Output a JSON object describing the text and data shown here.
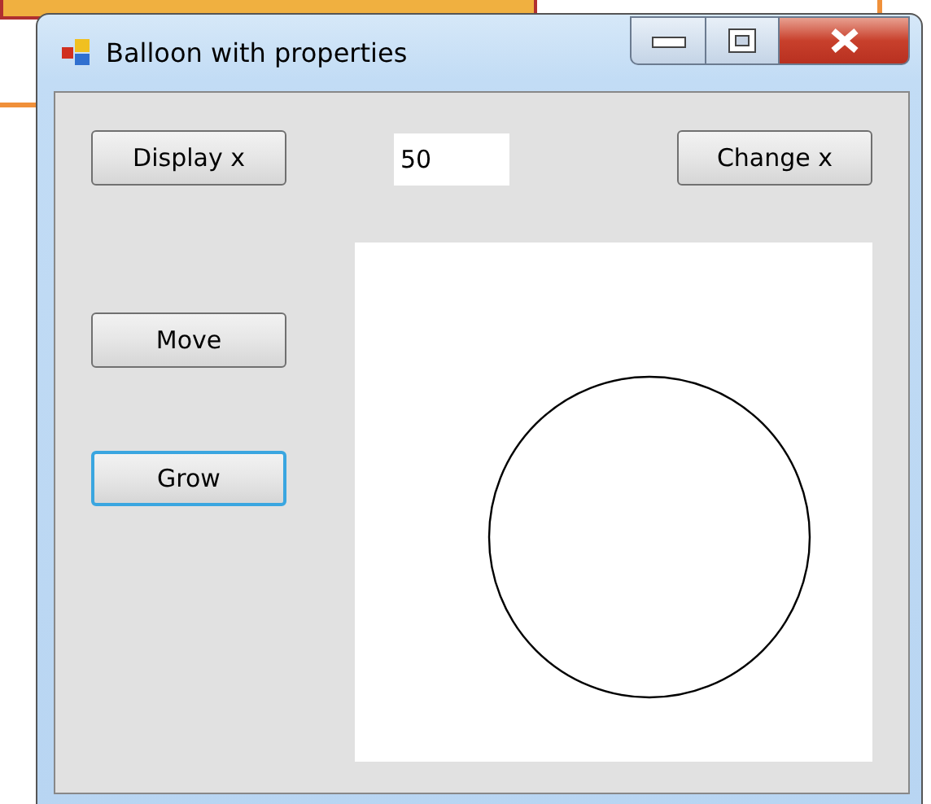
{
  "window": {
    "title": "Balloon with properties"
  },
  "display_button": {
    "label": "Display x",
    "focused": false
  },
  "x_field": {
    "value": "50"
  },
  "change_button": {
    "label": "Change x",
    "focused": false
  },
  "side_buttons": [
    {
      "label": "Move",
      "focused": false
    },
    {
      "label": "Grow",
      "focused": true
    }
  ]
}
